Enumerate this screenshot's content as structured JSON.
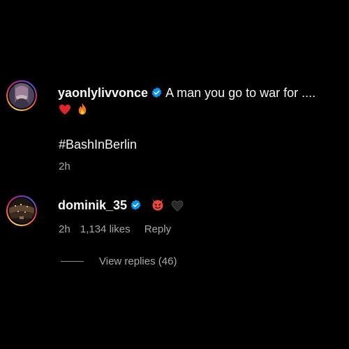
{
  "comments": [
    {
      "username": "yaonlylivvonce",
      "verified": true,
      "text": "A man you go to war for ....",
      "emojis": [
        "red-heart",
        "fire"
      ],
      "hashtag": "#BashInBerlin",
      "time": "2h"
    },
    {
      "username": "dominik_35",
      "verified": true,
      "emojis": [
        "smiling-devil",
        "black-heart"
      ],
      "time": "2h",
      "likes": "1,134 likes",
      "reply_label": "Reply"
    }
  ],
  "view_replies": "View replies (46)",
  "colors": {
    "background": "#000000",
    "text": "#f5f5f5",
    "muted": "#a8a8a8",
    "verified": "#0095f6"
  }
}
